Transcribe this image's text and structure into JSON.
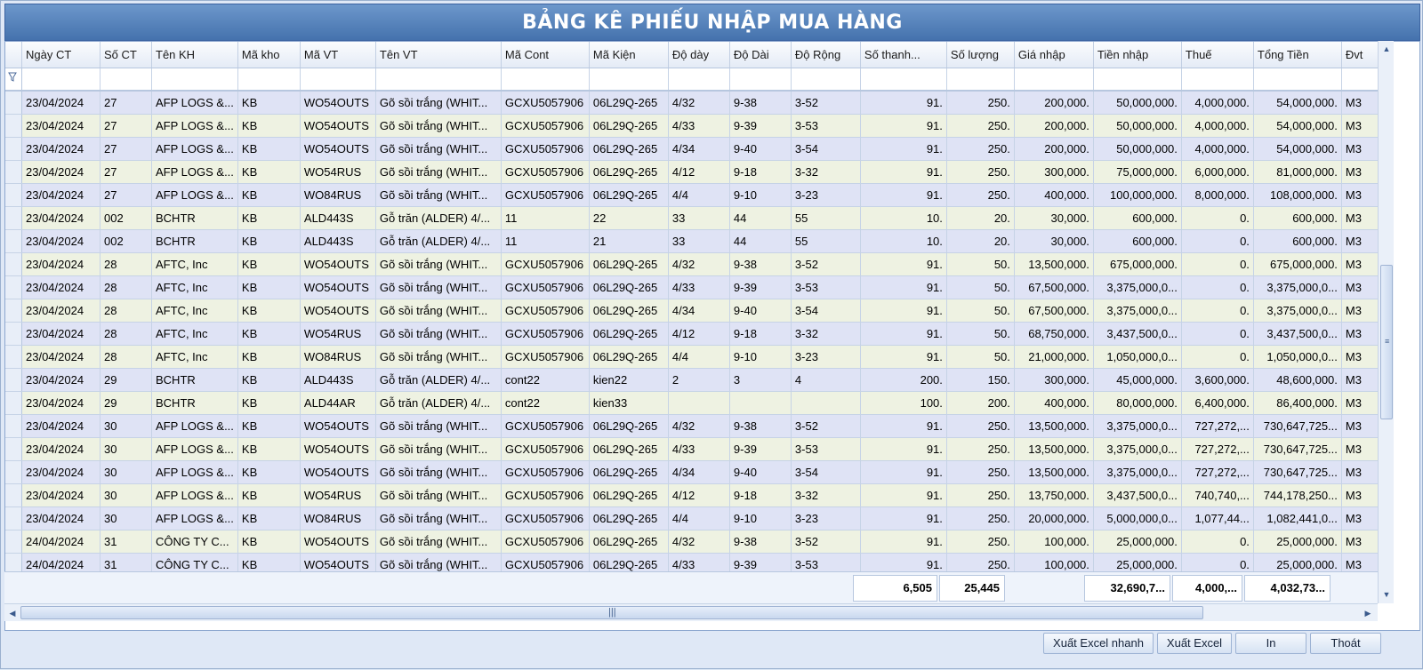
{
  "window": {
    "title": "BẢNG KÊ PHIẾU NHẬP MUA HÀNG"
  },
  "columns": [
    "Ngày CT",
    "Số CT",
    "Tên KH",
    "Mã kho",
    "Mã VT",
    "Tên VT",
    "Mã Cont",
    "Mã Kiện",
    "Độ dày",
    "Độ Dài",
    "Độ Rộng",
    "Số thanh...",
    "Số lượng",
    "Giá nhập",
    "Tiền nhập",
    "Thuế",
    "Tổng Tiền",
    "Đvt"
  ],
  "filter_icon": "funnel-icon",
  "rows": [
    [
      "23/04/2024",
      "27",
      "AFP LOGS &...",
      "KB",
      "WO54OUTS",
      "Gõ sồi trắng (WHIT...",
      "GCXU5057906",
      "06L29Q-265",
      "4/32",
      "9-38",
      "3-52",
      "91.",
      "250.",
      "200,000.",
      "50,000,000.",
      "4,000,000.",
      "54,000,000.",
      "M3"
    ],
    [
      "23/04/2024",
      "27",
      "AFP LOGS &...",
      "KB",
      "WO54OUTS",
      "Gõ sồi trắng (WHIT...",
      "GCXU5057906",
      "06L29Q-265",
      "4/33",
      "9-39",
      "3-53",
      "91.",
      "250.",
      "200,000.",
      "50,000,000.",
      "4,000,000.",
      "54,000,000.",
      "M3"
    ],
    [
      "23/04/2024",
      "27",
      "AFP LOGS &...",
      "KB",
      "WO54OUTS",
      "Gõ sồi trắng (WHIT...",
      "GCXU5057906",
      "06L29Q-265",
      "4/34",
      "9-40",
      "3-54",
      "91.",
      "250.",
      "200,000.",
      "50,000,000.",
      "4,000,000.",
      "54,000,000.",
      "M3"
    ],
    [
      "23/04/2024",
      "27",
      "AFP LOGS &...",
      "KB",
      "WO54RUS",
      "Gõ sồi trắng (WHIT...",
      "GCXU5057906",
      "06L29Q-265",
      "4/12",
      "9-18",
      "3-32",
      "91.",
      "250.",
      "300,000.",
      "75,000,000.",
      "6,000,000.",
      "81,000,000.",
      "M3"
    ],
    [
      "23/04/2024",
      "27",
      "AFP LOGS &...",
      "KB",
      "WO84RUS",
      "Gõ sồi trắng (WHIT...",
      "GCXU5057906",
      "06L29Q-265",
      "4/4",
      "9-10",
      "3-23",
      "91.",
      "250.",
      "400,000.",
      "100,000,000.",
      "8,000,000.",
      "108,000,000.",
      "M3"
    ],
    [
      "23/04/2024",
      "002",
      "BCHTR",
      "KB",
      "ALD443S",
      "Gỗ trăn (ALDER) 4/...",
      "11",
      "22",
      "33",
      "44",
      "55",
      "10.",
      "20.",
      "30,000.",
      "600,000.",
      "0.",
      "600,000.",
      "M3"
    ],
    [
      "23/04/2024",
      "002",
      "BCHTR",
      "KB",
      "ALD443S",
      "Gỗ trăn (ALDER) 4/...",
      "11",
      "21",
      "33",
      "44",
      "55",
      "10.",
      "20.",
      "30,000.",
      "600,000.",
      "0.",
      "600,000.",
      "M3"
    ],
    [
      "23/04/2024",
      "28",
      "AFTC, Inc",
      "KB",
      "WO54OUTS",
      "Gõ sồi trắng (WHIT...",
      "GCXU5057906",
      "06L29Q-265",
      "4/32",
      "9-38",
      "3-52",
      "91.",
      "50.",
      "13,500,000.",
      "675,000,000.",
      "0.",
      "675,000,000.",
      "M3"
    ],
    [
      "23/04/2024",
      "28",
      "AFTC, Inc",
      "KB",
      "WO54OUTS",
      "Gõ sồi trắng (WHIT...",
      "GCXU5057906",
      "06L29Q-265",
      "4/33",
      "9-39",
      "3-53",
      "91.",
      "50.",
      "67,500,000.",
      "3,375,000,0...",
      "0.",
      "3,375,000,0...",
      "M3"
    ],
    [
      "23/04/2024",
      "28",
      "AFTC, Inc",
      "KB",
      "WO54OUTS",
      "Gõ sồi trắng (WHIT...",
      "GCXU5057906",
      "06L29Q-265",
      "4/34",
      "9-40",
      "3-54",
      "91.",
      "50.",
      "67,500,000.",
      "3,375,000,0...",
      "0.",
      "3,375,000,0...",
      "M3"
    ],
    [
      "23/04/2024",
      "28",
      "AFTC, Inc",
      "KB",
      "WO54RUS",
      "Gõ sồi trắng (WHIT...",
      "GCXU5057906",
      "06L29Q-265",
      "4/12",
      "9-18",
      "3-32",
      "91.",
      "50.",
      "68,750,000.",
      "3,437,500,0...",
      "0.",
      "3,437,500,0...",
      "M3"
    ],
    [
      "23/04/2024",
      "28",
      "AFTC, Inc",
      "KB",
      "WO84RUS",
      "Gõ sồi trắng (WHIT...",
      "GCXU5057906",
      "06L29Q-265",
      "4/4",
      "9-10",
      "3-23",
      "91.",
      "50.",
      "21,000,000.",
      "1,050,000,0...",
      "0.",
      "1,050,000,0...",
      "M3"
    ],
    [
      "23/04/2024",
      "29",
      "BCHTR",
      "KB",
      "ALD443S",
      "Gỗ trăn (ALDER) 4/...",
      "cont22",
      "kien22",
      "2",
      "3",
      "4",
      "200.",
      "150.",
      "300,000.",
      "45,000,000.",
      "3,600,000.",
      "48,600,000.",
      "M3"
    ],
    [
      "23/04/2024",
      "29",
      "BCHTR",
      "KB",
      "ALD44AR",
      "Gỗ trăn (ALDER) 4/...",
      "cont22",
      "kien33",
      "",
      "",
      "",
      "100.",
      "200.",
      "400,000.",
      "80,000,000.",
      "6,400,000.",
      "86,400,000.",
      "M3"
    ],
    [
      "23/04/2024",
      "30",
      "AFP LOGS &...",
      "KB",
      "WO54OUTS",
      "Gõ sồi trắng (WHIT...",
      "GCXU5057906",
      "06L29Q-265",
      "4/32",
      "9-38",
      "3-52",
      "91.",
      "250.",
      "13,500,000.",
      "3,375,000,0...",
      "727,272,...",
      "730,647,725...",
      "M3"
    ],
    [
      "23/04/2024",
      "30",
      "AFP LOGS &...",
      "KB",
      "WO54OUTS",
      "Gõ sồi trắng (WHIT...",
      "GCXU5057906",
      "06L29Q-265",
      "4/33",
      "9-39",
      "3-53",
      "91.",
      "250.",
      "13,500,000.",
      "3,375,000,0...",
      "727,272,...",
      "730,647,725...",
      "M3"
    ],
    [
      "23/04/2024",
      "30",
      "AFP LOGS &...",
      "KB",
      "WO54OUTS",
      "Gõ sồi trắng (WHIT...",
      "GCXU5057906",
      "06L29Q-265",
      "4/34",
      "9-40",
      "3-54",
      "91.",
      "250.",
      "13,500,000.",
      "3,375,000,0...",
      "727,272,...",
      "730,647,725...",
      "M3"
    ],
    [
      "23/04/2024",
      "30",
      "AFP LOGS &...",
      "KB",
      "WO54RUS",
      "Gõ sồi trắng (WHIT...",
      "GCXU5057906",
      "06L29Q-265",
      "4/12",
      "9-18",
      "3-32",
      "91.",
      "250.",
      "13,750,000.",
      "3,437,500,0...",
      "740,740,...",
      "744,178,250...",
      "M3"
    ],
    [
      "23/04/2024",
      "30",
      "AFP LOGS &...",
      "KB",
      "WO84RUS",
      "Gõ sồi trắng (WHIT...",
      "GCXU5057906",
      "06L29Q-265",
      "4/4",
      "9-10",
      "3-23",
      "91.",
      "250.",
      "20,000,000.",
      "5,000,000,0...",
      "1,077,44...",
      "1,082,441,0...",
      "M3"
    ],
    [
      "24/04/2024",
      "31",
      "CÔNG TY C...",
      "KB",
      "WO54OUTS",
      "Gõ sồi trắng (WHIT...",
      "GCXU5057906",
      "06L29Q-265",
      "4/32",
      "9-38",
      "3-52",
      "91.",
      "250.",
      "100,000.",
      "25,000,000.",
      "0.",
      "25,000,000.",
      "M3"
    ],
    [
      "24/04/2024",
      "31",
      "CÔNG TY C...",
      "KB",
      "WO54OUTS",
      "Gõ sồi trắng (WHIT...",
      "GCXU5057906",
      "06L29Q-265",
      "4/33",
      "9-39",
      "3-53",
      "91.",
      "250.",
      "100,000.",
      "25,000,000.",
      "0.",
      "25,000,000.",
      "M3"
    ]
  ],
  "totals": {
    "so_thanh": "6,505",
    "so_luong": "25,445",
    "tien_nhap": "32,690,7...",
    "thue": "4,000,...",
    "tong_tien": "4,032,73..."
  },
  "buttons": {
    "export_fast": "Xuất Excel nhanh",
    "export": "Xuất Excel",
    "print": "In",
    "exit": "Thoát"
  }
}
